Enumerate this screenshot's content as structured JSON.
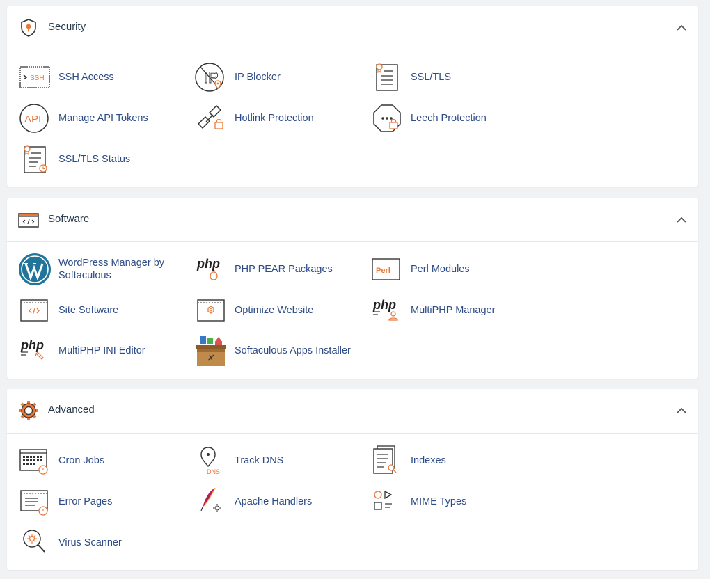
{
  "colors": {
    "link": "#2d4b86",
    "accent": "#e8793a",
    "icon_stroke": "#333333",
    "panel_bg": "#ffffff",
    "page_bg": "#f1f2f4"
  },
  "sections": [
    {
      "title": "Security",
      "icon": "security-shield-icon",
      "items": [
        {
          "label": "SSH Access",
          "icon": "ssh-icon"
        },
        {
          "label": "IP Blocker",
          "icon": "ip-blocker-icon"
        },
        {
          "label": "SSL/TLS",
          "icon": "ssl-certificate-icon"
        },
        {
          "label": "Manage API Tokens",
          "icon": "api-icon"
        },
        {
          "label": "Hotlink Protection",
          "icon": "hotlink-chain-icon"
        },
        {
          "label": "Leech Protection",
          "icon": "leech-protection-icon"
        },
        {
          "label": "SSL/TLS Status",
          "icon": "ssl-status-icon"
        }
      ]
    },
    {
      "title": "Software",
      "icon": "software-code-icon",
      "items": [
        {
          "label": "WordPress Manager by Softaculous",
          "icon": "wordpress-icon"
        },
        {
          "label": "PHP PEAR Packages",
          "icon": "php-pear-icon"
        },
        {
          "label": "Perl Modules",
          "icon": "perl-icon",
          "badge": "Perl"
        },
        {
          "label": "Site Software",
          "icon": "site-software-icon"
        },
        {
          "label": "Optimize Website",
          "icon": "optimize-website-icon"
        },
        {
          "label": "MultiPHP Manager",
          "icon": "multiphp-manager-icon"
        },
        {
          "label": "MultiPHP INI Editor",
          "icon": "multiphp-ini-icon"
        },
        {
          "label": "Softaculous Apps Installer",
          "icon": "softaculous-box-icon"
        }
      ]
    },
    {
      "title": "Advanced",
      "icon": "advanced-gear-icon",
      "items": [
        {
          "label": "Cron Jobs",
          "icon": "cron-calendar-icon"
        },
        {
          "label": "Track DNS",
          "icon": "track-dns-icon"
        },
        {
          "label": "Indexes",
          "icon": "indexes-icon"
        },
        {
          "label": "Error Pages",
          "icon": "error-pages-icon"
        },
        {
          "label": "Apache Handlers",
          "icon": "apache-feather-icon"
        },
        {
          "label": "MIME Types",
          "icon": "mime-types-icon"
        },
        {
          "label": "Virus Scanner",
          "icon": "virus-scanner-icon"
        }
      ]
    }
  ],
  "icon_text": {
    "ssh": "SSH",
    "ip": "IP",
    "api": "API",
    "php": "php",
    "dns": "DNS",
    "perl": "Perl"
  }
}
